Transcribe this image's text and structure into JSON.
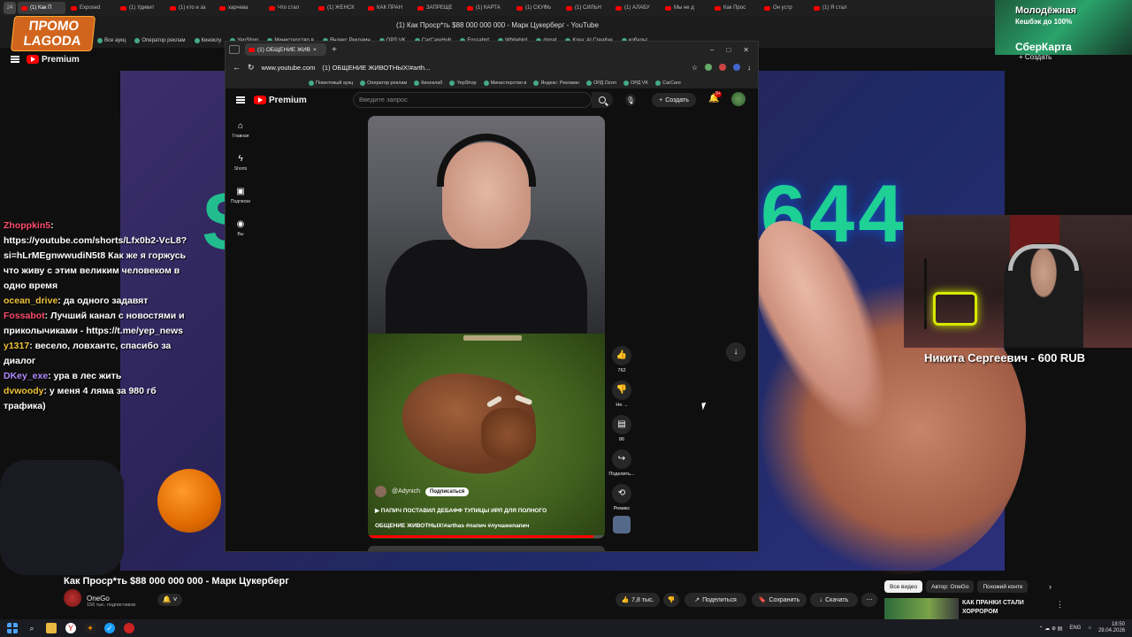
{
  "outer_browser": {
    "tab_count": "24",
    "tabs": [
      "(1) Как П",
      "Exposed",
      "(1) Удивит",
      "(1) кто и за",
      "харчева",
      "Что стал",
      "(1) ЖЕНСК",
      "КАК ПРАН",
      "ЗАПРЕЩЕ",
      "(1) КАРТА",
      "(1) СКУФЬ",
      "(1) СИЛЬН",
      "(1) АЛАБУ",
      "Мы не д",
      "Как Прос",
      "Он устр",
      "(1) Я стал"
    ],
    "title": "(1) Как Проср*ть $88 000 000 000 - Марк Цукерберг - YouTube",
    "bookmarks": [
      "Все аукц",
      "Оператор реклам",
      "Киноклу",
      "YepShop",
      "Министерство в",
      "Яндекс.Рекламн",
      "ОРД VK",
      "CarCareHub",
      "Fossabot",
      "Whitebird",
      "donat",
      "Krea: AI Creative",
      "кобальт"
    ],
    "yt_brand": "Premium",
    "promo_line1": "ПРОМО",
    "promo_line2": "LAGODA"
  },
  "ad": {
    "line1": "Молодёжная",
    "line2": "Кешбэк до 100%",
    "line3": "СберКарта",
    "create": "+ Создать"
  },
  "chat": [
    {
      "user": "Zhoppkin5",
      "text": ":",
      "color": "#ff4d6d"
    },
    {
      "user": "",
      "text": "https://youtube.com/shorts/Lfx0b2-VcL8?si=hLrMEgnwwudiN5t8 Как же я горжусь что живу с этим великим человеком в одно время",
      "color": "#ffffff"
    },
    {
      "user": "ocean_drive",
      "text": ": да одного задавят",
      "color": "#f0c33a"
    },
    {
      "user": "Fossabot",
      "text": ": Лучший канал с новостями и приколычиками - https://t.me/yep_news",
      "color": "#ff4d6d"
    },
    {
      "user": "y1317",
      "text": ": весело, ловхантс, спасибо за диалог",
      "color": "#f0c33a"
    },
    {
      "user": "DKey_exe",
      "text": ": ура в лес жить",
      "color": "#b18cff"
    },
    {
      "user": "dvwoody",
      "text": ": у меня 4 ляма за 980 гб трафика)",
      "color": "#f0c33a"
    }
  ],
  "webcam": {
    "donation": "Никита Сергеевич - 600 RUB"
  },
  "background": {
    "number": "644"
  },
  "inner_browser": {
    "tab_title": "(1) ОБЩЕНИЕ ЖИВ",
    "url": "www.youtube.com",
    "page_title": "(1) ОБЩЕНИЕ ЖИВОТНЫХ!#arth...",
    "bookmarks": [
      "Помнтовый аукц",
      "Оператор реклам",
      "Киноклаб",
      "YepShop",
      "Министерство в",
      "Яндекс: Рекламн",
      "ОРД Ozon",
      "ОРД VK",
      "CarCare"
    ],
    "yt_brand": "Premium",
    "search_placeholder": "Введите запрос",
    "create_label": "Создать",
    "notif_count": "9+",
    "nav": [
      {
        "label": "Главная",
        "icon": "home-icon"
      },
      {
        "label": "Shorts",
        "icon": "shorts-icon"
      },
      {
        "label": "Подписки",
        "icon": "subscriptions-icon"
      },
      {
        "label": "Вы",
        "icon": "you-icon"
      }
    ],
    "short": {
      "channel": "@Adynich",
      "subscribe": "Подписаться",
      "title_line1": "▶ ПАПИЧ ПОСТАВИЛ ДЕБАФФ ТУПИЦЫ ИРЛ ДЛЯ ПОЛНОГО",
      "title_line2": "ОБЩЕНИЕ ЖИВОТНЫХ!#arthas #папич #лучшеепапич",
      "progress": 0.95
    },
    "actions": [
      {
        "label": "762",
        "icon": "like-icon"
      },
      {
        "label": "Не ...",
        "icon": "dislike-icon"
      },
      {
        "label": "86",
        "icon": "comment-icon"
      },
      {
        "label": "Поделить...",
        "icon": "share-icon"
      },
      {
        "label": "Ремикс",
        "icon": "remix-icon"
      }
    ]
  },
  "host_video": {
    "title": "Как Проср*ть $88 000 000 000 - Марк Цукерберг",
    "channel": "OneGo",
    "subs": "156 тыс. подписчиков",
    "likes": "7,8 тыс.",
    "share": "Поделиться",
    "save": "Сохранить",
    "download": "Скачать",
    "chips": [
      "Все видео",
      "Автор: OneGo",
      "Похожий конте"
    ],
    "rec_title": "КАК ПРАНКИ СТАЛИ ХОРРОРОМ"
  },
  "taskbar": {
    "lang": "ENG",
    "time": "18:50",
    "date": "29.04.2026"
  }
}
